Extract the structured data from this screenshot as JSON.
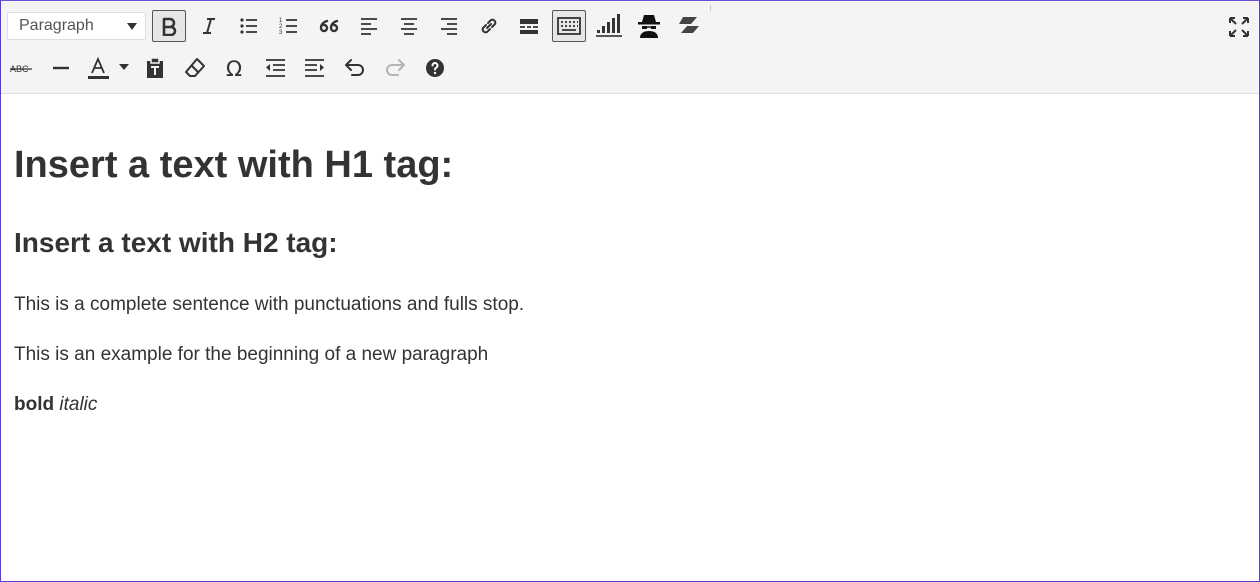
{
  "toolbar": {
    "format_select": {
      "value": "Paragraph"
    },
    "row1": [
      {
        "name": "bold-icon",
        "active": true
      },
      {
        "name": "italic-icon"
      },
      {
        "name": "bullet-list-icon"
      },
      {
        "name": "numbered-list-icon"
      },
      {
        "name": "blockquote-icon"
      },
      {
        "name": "align-left-icon"
      },
      {
        "name": "align-center-icon"
      },
      {
        "name": "align-right-icon"
      },
      {
        "name": "link-icon"
      },
      {
        "name": "read-more-icon"
      },
      {
        "name": "toolbar-toggle-icon",
        "active": true
      },
      {
        "name": "quads-ads-icon"
      },
      {
        "name": "incognito-icon"
      },
      {
        "name": "layers-icon"
      }
    ],
    "row2": [
      {
        "name": "strikethrough-icon"
      },
      {
        "name": "horizontal-line-icon"
      },
      {
        "name": "text-color-icon"
      },
      {
        "name": "paste-as-text-icon"
      },
      {
        "name": "clear-formatting-icon"
      },
      {
        "name": "special-character-icon"
      },
      {
        "name": "outdent-icon"
      },
      {
        "name": "indent-icon"
      },
      {
        "name": "undo-icon"
      },
      {
        "name": "redo-icon",
        "disabled": true
      },
      {
        "name": "help-icon"
      }
    ],
    "colors": {
      "toolbar_bg": "#f4f4f4",
      "icon": "#333333",
      "frame_border": "#5b3ec8"
    }
  },
  "content": {
    "h1": "Insert a text with H1 tag:",
    "h2": "Insert a text with H2 tag:",
    "paragraph1": "This is a complete sentence with punctuations and fulls stop.",
    "paragraph2": "This is an example for the beginning of a new paragraph",
    "bold_text": "bold",
    "italic_text": "italic"
  }
}
